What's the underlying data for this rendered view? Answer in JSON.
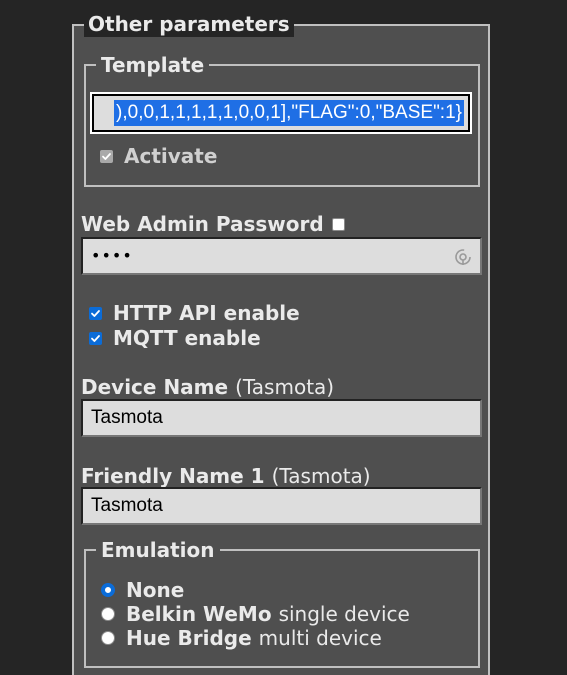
{
  "other_parameters": {
    "legend": "Other parameters"
  },
  "template": {
    "legend": "Template",
    "value_visible": "),0,0,1,1,1,1,1,0,0,1],\"FLAG\":0,\"BASE\":1}",
    "activate_label": "Activate",
    "activate_checked": true,
    "activate_disabled": true
  },
  "web_admin_password": {
    "label": "Web Admin Password",
    "show_checked": false,
    "value_masked": "••••",
    "icon": "password-reveal-icon"
  },
  "options": {
    "http_api_label": "HTTP API enable",
    "http_api_checked": true,
    "mqtt_label": "MQTT enable",
    "mqtt_checked": true
  },
  "device_name": {
    "label": "Device Name",
    "hint": "(Tasmota)",
    "value": "Tasmota"
  },
  "friendly_name_1": {
    "label": "Friendly Name 1",
    "hint": "(Tasmota)",
    "value": "Tasmota"
  },
  "emulation": {
    "legend": "Emulation",
    "options": [
      {
        "name": "None",
        "suffix": "",
        "selected": true
      },
      {
        "name": "Belkin WeMo",
        "suffix": "single device",
        "selected": false
      },
      {
        "name": "Hue Bridge",
        "suffix": "multi device",
        "selected": false
      }
    ]
  },
  "colors": {
    "page_background": "#252525",
    "panel_background": "#4f4f4f",
    "field_background": "#dddddd",
    "accent": "#0b6cd8",
    "selection": "#1f6fe5",
    "text": "#eaeaea"
  }
}
